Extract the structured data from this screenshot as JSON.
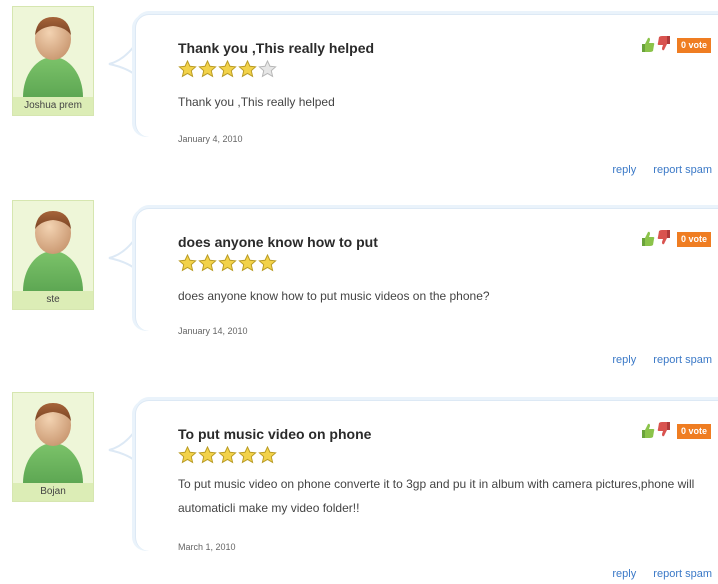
{
  "comments": [
    {
      "user": "Joshua prem",
      "title": "Thank you ,This really helped",
      "rating": 4,
      "body": "Thank you ,This really helped",
      "date": "January 4, 2010",
      "vote": "0 vote"
    },
    {
      "user": "ste",
      "title": "does anyone know how to put",
      "rating": 5,
      "body": "does anyone know how to put music videos on the phone?",
      "date": "January 14, 2010",
      "vote": "0 vote"
    },
    {
      "user": "Bojan",
      "title": "To put music video on phone",
      "rating": 5,
      "body": "To put music video on phone converte it to 3gp and pu it in album with camera pictures,phone will automaticli make my video folder!!",
      "date": "March 1, 2010",
      "vote": "0 vote"
    }
  ],
  "actions": {
    "reply": "reply",
    "report_spam": "report spam"
  },
  "colors": {
    "vote_badge": "#ef7d22",
    "link": "#3b79c7",
    "avatar_bg": "#eef6d8",
    "star_fill": "#f2d24a",
    "star_empty": "#e6e6e6"
  },
  "icons": [
    "thumbs-up-icon",
    "thumbs-down-icon",
    "star-icon",
    "avatar-icon"
  ]
}
